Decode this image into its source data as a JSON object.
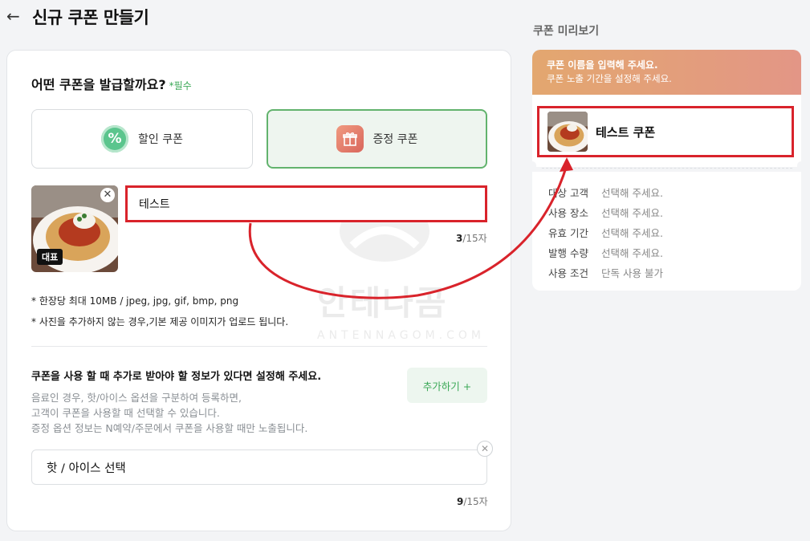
{
  "header": {
    "title": "신규 쿠폰 만들기"
  },
  "issue": {
    "question": "어떤 쿠폰을 발급할까요?",
    "required": "*필수",
    "types": [
      {
        "label": "할인 쿠폰",
        "icon": "percent-icon",
        "selected": false
      },
      {
        "label": "증정 쿠폰",
        "icon": "gift-icon",
        "selected": true
      }
    ]
  },
  "image": {
    "badge": "대표"
  },
  "name": {
    "value": "테스트",
    "count_current": "3",
    "count_max": "/15자"
  },
  "notes": [
    "* 한장당 최대 10MB / jpeg, jpg, gif, bmp, png",
    "* 사진을 추가하지 않는 경우,기본 제공 이미지가 업로드 됩니다."
  ],
  "option": {
    "title": "쿠폰을 사용 할 때 추가로 받아야 할 정보가 있다면 설정해 주세요.",
    "desc": [
      "음료인 경우, 핫/아이스 옵션을 구분하여 등록하면,",
      "고객이 쿠폰을 사용할 때 선택할 수 있습니다.",
      "증정 옵션 정보는 N예약/주문에서 쿠폰을 사용할 때만 노출됩니다."
    ],
    "add_label": "추가하기 +",
    "value": "핫 / 아이스 선택",
    "count_current": "9",
    "count_max": "/15자"
  },
  "preview": {
    "label": "쿠폰 미리보기",
    "banner_line1": "쿠폰 이름을 입력해 주세요.",
    "banner_line2": "쿠폰 노출 기간을 설정해 주세요.",
    "item_name": "테스트 쿠폰",
    "rows": [
      {
        "key": "대상 고객",
        "value": "선택해 주세요."
      },
      {
        "key": "사용 장소",
        "value": "선택해 주세요."
      },
      {
        "key": "유효 기간",
        "value": "선택해 주세요."
      },
      {
        "key": "발행 수량",
        "value": "선택해 주세요."
      },
      {
        "key": "사용 조건",
        "value": "단독 사용 불가"
      }
    ]
  },
  "watermark": {
    "text": "안테나곰",
    "sub": "ANTENNAGOM.COM"
  },
  "colors": {
    "accent_green": "#3aa856",
    "highlight_red": "#d9232b",
    "banner_from": "#e3a76f",
    "banner_to": "#e39686"
  }
}
